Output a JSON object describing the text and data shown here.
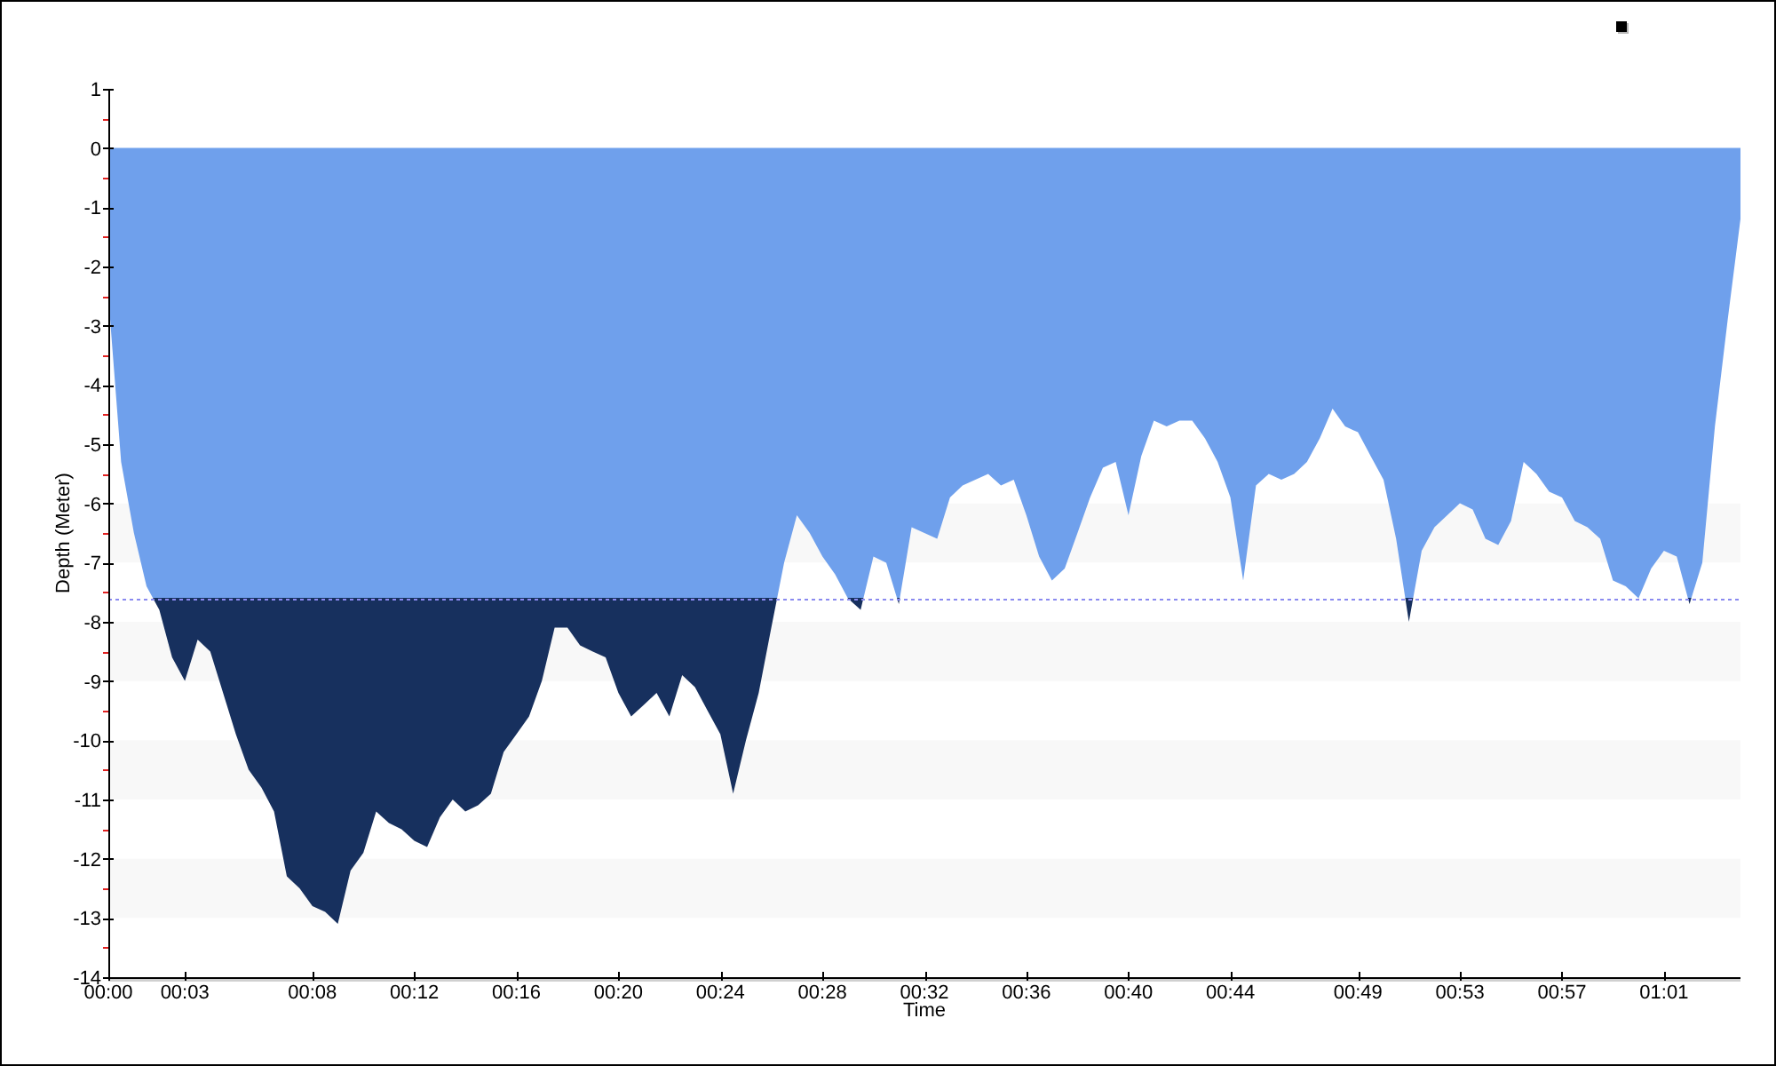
{
  "chart": {
    "chart_data": {
      "type": "area",
      "xlabel": "Time",
      "ylabel": "Depth (Meter)",
      "x": [
        0,
        0.5,
        1,
        1.5,
        2,
        2.5,
        3,
        3.5,
        4,
        4.5,
        5,
        5.5,
        6,
        6.5,
        7,
        7.5,
        8,
        8.5,
        9,
        9.5,
        10,
        10.5,
        11,
        11.5,
        12,
        12.5,
        13,
        13.5,
        14,
        14.5,
        15,
        15.5,
        16,
        16.5,
        17,
        17.5,
        18,
        18.5,
        19,
        19.5,
        20,
        20.5,
        21,
        21.5,
        22,
        22.5,
        23,
        23.5,
        24,
        24.5,
        25,
        25.5,
        26,
        26.5,
        27,
        27.5,
        28,
        28.5,
        29,
        29.5,
        30,
        30.5,
        31,
        31.5,
        32,
        32.5,
        33,
        33.5,
        34,
        34.5,
        35,
        35.5,
        36,
        36.5,
        37,
        37.5,
        38,
        38.5,
        39,
        39.5,
        40,
        40.5,
        41,
        41.5,
        42,
        42.5,
        43,
        43.5,
        44,
        44.5,
        45,
        45.5,
        46,
        46.5,
        47,
        47.5,
        48,
        48.5,
        49,
        49.5,
        50,
        50.5,
        51,
        51.5,
        52,
        52.5,
        53,
        53.5,
        54,
        54.5,
        55,
        55.5,
        56,
        56.5,
        57,
        57.5,
        58,
        58.5,
        59,
        59.5,
        60,
        60.5,
        61,
        61.5,
        62,
        62.5,
        63,
        63.5,
        64
      ],
      "series": [
        {
          "color": "#6fa0ec",
          "values": [
            -2.5,
            -5.3,
            -6.5,
            -7.4,
            -7.8,
            -8.6,
            -9.0,
            -8.3,
            -8.5,
            -9.2,
            -9.9,
            -10.5,
            -10.8,
            -11.2,
            -12.3,
            -12.5,
            -12.8,
            -12.9,
            -13.1,
            -12.2,
            -11.9,
            -11.2,
            -11.4,
            -11.5,
            -11.7,
            -11.8,
            -11.3,
            -11.0,
            -11.2,
            -11.1,
            -10.9,
            -10.2,
            -9.9,
            -9.6,
            -9.0,
            -8.1,
            -8.1,
            -8.4,
            -8.5,
            -8.6,
            -9.2,
            -9.6,
            -9.4,
            -9.2,
            -9.6,
            -8.9,
            -9.1,
            -9.5,
            -9.9,
            -10.9,
            -10.0,
            -9.2,
            -8.1,
            -7.0,
            -6.2,
            -6.5,
            -6.9,
            -7.2,
            -7.6,
            -7.8,
            -6.9,
            -7.0,
            -7.7,
            -6.4,
            -6.5,
            -6.6,
            -5.9,
            -5.7,
            -5.6,
            -5.5,
            -5.7,
            -5.6,
            -6.2,
            -6.9,
            -7.3,
            -7.1,
            -6.5,
            -5.9,
            -5.4,
            -5.3,
            -6.2,
            -5.2,
            -4.6,
            -4.7,
            -4.6,
            -4.6,
            -4.9,
            -5.3,
            -5.9,
            -7.3,
            -5.7,
            -5.5,
            -5.6,
            -5.5,
            -5.3,
            -4.9,
            -4.4,
            -4.7,
            -4.8,
            -5.2,
            -5.6,
            -6.6,
            -8.0,
            -6.8,
            -6.4,
            -6.2,
            -6.0,
            -6.1,
            -6.6,
            -6.7,
            -6.3,
            -5.3,
            -5.5,
            -5.8,
            -5.9,
            -6.3,
            -6.4,
            -6.6,
            -7.3,
            -7.4,
            -7.6,
            -7.1,
            -6.8,
            -6.9,
            -7.7,
            -7.0,
            -4.7,
            -2.9,
            -1.2
          ]
        }
      ],
      "xlim": [
        0,
        64
      ],
      "ylim": [
        -14,
        1
      ],
      "xticks": [
        {
          "value": 0,
          "label": "00:00"
        },
        {
          "value": 3,
          "label": "00:03"
        },
        {
          "value": 8,
          "label": "00:08"
        },
        {
          "value": 12,
          "label": "00:12"
        },
        {
          "value": 16,
          "label": "00:16"
        },
        {
          "value": 20,
          "label": "00:20"
        },
        {
          "value": 24,
          "label": "00:24"
        },
        {
          "value": 28,
          "label": "00:28"
        },
        {
          "value": 32,
          "label": "00:32"
        },
        {
          "value": 36,
          "label": "00:36"
        },
        {
          "value": 40,
          "label": "00:40"
        },
        {
          "value": 44,
          "label": "00:44"
        },
        {
          "value": 49,
          "label": "00:49"
        },
        {
          "value": 53,
          "label": "00:53"
        },
        {
          "value": 57,
          "label": "00:57"
        },
        {
          "value": 61,
          "label": "01:01"
        }
      ],
      "yticks": [
        1,
        0,
        -1,
        -2,
        -3,
        -4,
        -5,
        -6,
        -7,
        -8,
        -9,
        -10,
        -11,
        -12,
        -13,
        -14
      ],
      "ref_lines": [
        {
          "axis": "y",
          "value": -7.6
        }
      ]
    }
  }
}
